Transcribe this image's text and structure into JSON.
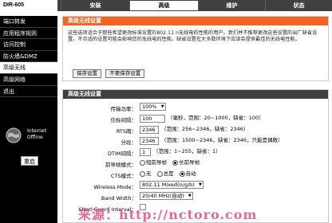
{
  "brand": "DIR-605",
  "tabs": [
    {
      "label": "安装",
      "active": false
    },
    {
      "label": "高级",
      "active": true
    },
    {
      "label": "维护",
      "active": false
    },
    {
      "label": "状态",
      "active": false
    }
  ],
  "sidebar": {
    "items": [
      {
        "label": "端口转发",
        "active": false
      },
      {
        "label": "应用程序规则",
        "active": false
      },
      {
        "label": "访问控制",
        "active": false
      },
      {
        "label": "防火墙&DMZ",
        "active": false
      },
      {
        "label": "高级无线",
        "active": true
      },
      {
        "label": "高级网络",
        "active": false
      },
      {
        "label": "退出",
        "active": false
      }
    ],
    "status_line1": "Internet",
    "status_line2": "Offline",
    "logout_label": "重启"
  },
  "intro": {
    "title": "高级无线设置",
    "description": "这些选项适合于那些希望更改标准设置的802.11 n无线电的性能的用户。我们并不推荐更改这些设置的出厂缺省设置。不合适的设置可能会影响您的无线电的性能。缺省设置在大多数环境下应该会提供最佳的无线电性能。",
    "save_label": "保存设置",
    "nosave_label": "不要保存设置"
  },
  "settings": {
    "title": "高级无线设置",
    "tx_power": {
      "label": "传输功率：",
      "value": "100%"
    },
    "beacon": {
      "label": "信标间隔：",
      "value": "100",
      "hint": "（毫秒，范围：20~1000，缺省：100）"
    },
    "rts": {
      "label": "RTS阈：",
      "value": "2346",
      "hint": "（范围：256~2346，缺省：2346）"
    },
    "frag": {
      "label": "分段：",
      "value": "2346",
      "hint": "（范围：1500~2346，缺省：2346，只能是偶数）"
    },
    "dtim": {
      "label": "DTIM间隔：",
      "value": "1",
      "hint": "（范围：1~255，缺省：1）"
    },
    "preamble": {
      "label": "前导帧模式：",
      "options": [
        "短前导帧",
        "长前导帧"
      ],
      "selected": 1
    },
    "cts": {
      "label": "CTS模式：",
      "options": [
        "无",
        "总是",
        "自动"
      ],
      "selected": 2
    },
    "wireless_mode": {
      "label": "Wireless Mode：",
      "value": "802.11 Mixed(n/g/b)"
    },
    "band_width": {
      "label": "Band Width：",
      "value": "20/40 MHz(自动)"
    },
    "short_gi": {
      "label": "Short Guard Interval："
    }
  },
  "watermark": "来源：http://nctoro.com"
}
